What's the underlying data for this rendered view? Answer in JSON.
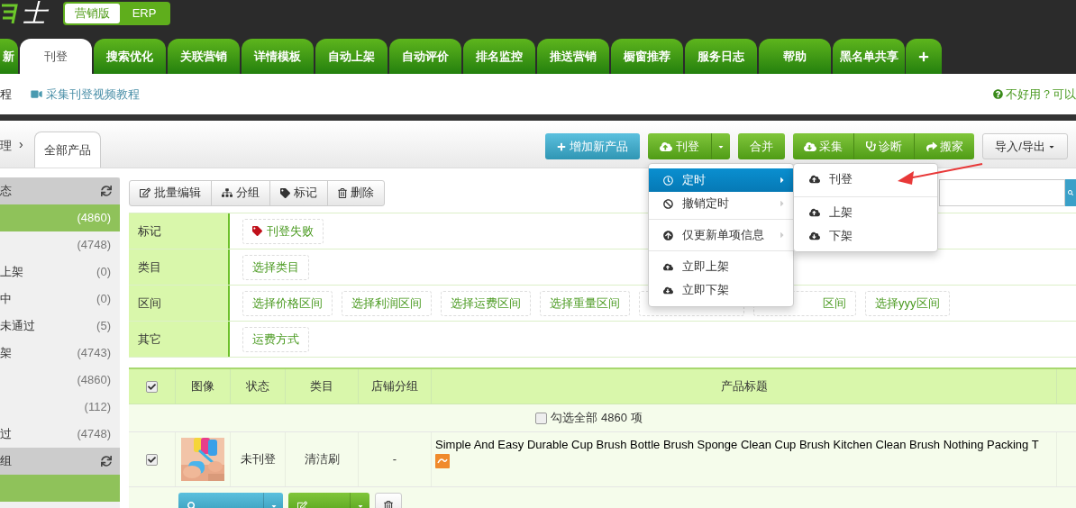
{
  "logo": "士",
  "edition_switch": [
    {
      "label": "营销版",
      "selected": true
    },
    {
      "label": "ERP",
      "selected": false
    }
  ],
  "nav_tabs": [
    {
      "label": "新",
      "selected": false
    },
    {
      "label": "刊登",
      "selected": true
    },
    {
      "label": "搜索优化",
      "selected": false
    },
    {
      "label": "关联营销",
      "selected": false
    },
    {
      "label": "详情模板",
      "selected": false
    },
    {
      "label": "自动上架",
      "selected": false
    },
    {
      "label": "自动评价",
      "selected": false
    },
    {
      "label": "排名监控",
      "selected": false
    },
    {
      "label": "推送营销",
      "selected": false
    },
    {
      "label": "橱窗推荐",
      "selected": false
    },
    {
      "label": "服务日志",
      "selected": false
    },
    {
      "label": "帮助",
      "selected": false
    },
    {
      "label": "黑名单共享",
      "selected": false
    }
  ],
  "help_bar": {
    "links": [
      {
        "kind": "text",
        "text": "程"
      },
      {
        "kind": "video",
        "text": "采集刊登视频教程"
      }
    ],
    "feedback": "不好用？可以"
  },
  "breadcrumb": {
    "parent": "理",
    "separator": "›",
    "current": "全部产品"
  },
  "toolbar": {
    "add_product": "增加新产品",
    "publish": "刊登",
    "merge": "合并",
    "tools": [
      {
        "kind": "collect",
        "label": "采集"
      },
      {
        "kind": "diagnose",
        "label": "诊断"
      },
      {
        "kind": "move",
        "label": "搬家"
      }
    ],
    "import_export": "导入/导出"
  },
  "publish_menu": {
    "groups": [
      [
        {
          "kind": "clock",
          "label": "定时",
          "selected": true,
          "has_submenu": true
        },
        {
          "kind": "ban",
          "label": "撤销定时",
          "selected": false,
          "has_submenu": true
        }
      ],
      [
        {
          "kind": "up",
          "label": "仅更新单项信息",
          "selected": false,
          "has_submenu": true
        }
      ],
      [
        {
          "kind": "upload",
          "label": "立即上架",
          "selected": false,
          "has_submenu": false
        },
        {
          "kind": "download",
          "label": "立即下架",
          "selected": false,
          "has_submenu": false
        }
      ]
    ]
  },
  "submenu": {
    "groups": [
      [
        {
          "kind": "upload",
          "label": "刊登"
        }
      ],
      [
        {
          "kind": "upload",
          "label": "上架"
        },
        {
          "kind": "download",
          "label": "下架"
        }
      ]
    ]
  },
  "sidebar": [
    {
      "title": "态",
      "items": [
        {
          "count": "(4860)",
          "selected": true
        },
        {
          "count": "(4748)",
          "selected": false
        },
        {
          "label": "上架",
          "count": "(0)",
          "selected": false
        },
        {
          "label": "中",
          "count": "(0)",
          "selected": false
        },
        {
          "label": "未通过",
          "count": "(5)",
          "selected": false
        },
        {
          "label": "架",
          "count": "(4743)",
          "selected": false
        },
        {
          "count": "(4860)",
          "selected": false
        },
        {
          "count": "(112)",
          "selected": false
        },
        {
          "label": "过",
          "count": "(4748)",
          "selected": false
        }
      ]
    },
    {
      "title": "组",
      "items": [
        {
          "selected": true
        }
      ]
    }
  ],
  "bulk_actions": [
    {
      "kind": "edit",
      "label": "批量编辑"
    },
    {
      "kind": "group",
      "label": "分组"
    },
    {
      "kind": "tag",
      "label": "标记"
    },
    {
      "kind": "delete",
      "label": "删除"
    }
  ],
  "filters": [
    {
      "label": "标记",
      "options": [
        {
          "kind": "tag",
          "text": "刊登失败"
        }
      ]
    },
    {
      "label": "类目",
      "options": [
        {
          "kind": "plain",
          "text": "选择类目"
        }
      ]
    },
    {
      "label": "区间",
      "options": [
        {
          "kind": "plain",
          "text": "选择价格区间"
        },
        {
          "kind": "plain",
          "text": "选择利润区间"
        },
        {
          "kind": "plain",
          "text": "选择运费区间"
        },
        {
          "kind": "plain",
          "text": "选择重量区间"
        },
        {
          "kind": "covered"
        },
        {
          "kind": "partial",
          "text": "区间"
        },
        {
          "kind": "plain",
          "text": "选择yyy区间"
        }
      ]
    },
    {
      "label": "其它",
      "options": [
        {
          "kind": "plain",
          "text": "运费方式"
        }
      ]
    }
  ],
  "table": {
    "header_checked": true,
    "columns": [
      "图像",
      "状态",
      "类目",
      "店铺分组",
      "产品标题"
    ],
    "select_all": {
      "checked": false,
      "label": "勾选全部 4860 项"
    },
    "rows": [
      {
        "checked": true,
        "status": "未刊登",
        "category": "清洁刷",
        "shop_group": "-",
        "title": "Simple And Easy Durable Cup Brush Bottle Brush Sponge Clean Cup Brush Kitchen Clean Brush Nothing Packing T",
        "actions": [
          {
            "kind": "view"
          },
          {
            "kind": "edit"
          },
          {
            "kind": "delete"
          }
        ]
      }
    ]
  }
}
